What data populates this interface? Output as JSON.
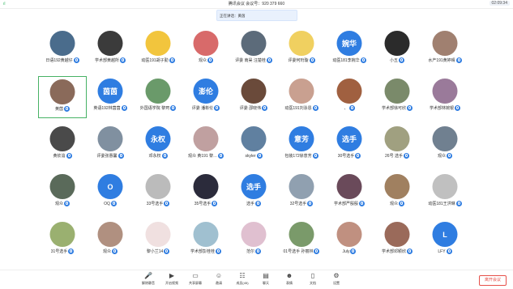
{
  "app": {
    "title_left": "腾讯会议",
    "title_sep": " 会议号：",
    "meeting_id": "920 379 660",
    "time": "02:09:34",
    "signal": "ıl"
  },
  "speaking_bar": {
    "label": "正在讲话：",
    "speaker": "黄茵"
  },
  "colors": {
    "accent": "#2f7de1",
    "leave": "#e6504a",
    "active_border": "#47b265"
  },
  "participants": [
    {
      "name": "日语192黄越仔",
      "avatar_text": "",
      "color": "#4a6c8c"
    },
    {
      "name": "学术部黄越所",
      "avatar_text": "",
      "color": "#3b3b3b"
    },
    {
      "name": "动医191胡子勤",
      "avatar_text": "",
      "color": "#f2c53d"
    },
    {
      "name": "观众",
      "avatar_text": "",
      "color": "#d86a6a"
    },
    {
      "name": "评委 南昊 汪楚桂",
      "avatar_text": "",
      "color": "#5c6b7a"
    },
    {
      "name": "评委何珩璇",
      "avatar_text": "",
      "color": "#f0d060"
    },
    {
      "name": "动医181李婉华",
      "avatar_text": "婉华",
      "color": "#2f7de1"
    },
    {
      "name": "小五",
      "avatar_text": "",
      "color": "#2b2b2b"
    },
    {
      "name": "水产191黄婷晴",
      "avatar_text": "",
      "color": "#a08070"
    },
    {
      "name": "黄茵",
      "avatar_text": "",
      "color": "#8a6a5a",
      "active": true
    },
    {
      "name": "英语192林茵茵",
      "avatar_text": "茵茵",
      "color": "#2f7de1"
    },
    {
      "name": "外国语学院 黎珂",
      "avatar_text": "",
      "color": "#6a9a6a"
    },
    {
      "name": "评委 潘彬伦",
      "avatar_text": "澎伦",
      "color": "#2f7de1"
    },
    {
      "name": "评委 邵晓伟",
      "avatar_text": "",
      "color": "#6a4a3a"
    },
    {
      "name": "动医191刘泳恩",
      "avatar_text": "",
      "color": "#c9a090"
    },
    {
      "name": "、",
      "avatar_text": "",
      "color": "#a06040"
    },
    {
      "name": "学术部徐可欣",
      "avatar_text": "",
      "color": "#7a8a6a"
    },
    {
      "name": "学术部林婉银",
      "avatar_text": "",
      "color": "#9a7a9a"
    },
    {
      "name": "黄钦渝",
      "avatar_text": "",
      "color": "#4a4a4a"
    },
    {
      "name": "评委张惠馨",
      "avatar_text": "",
      "color": "#8090a0"
    },
    {
      "name": "邓永权",
      "avatar_text": "永权",
      "color": "#2f7de1"
    },
    {
      "name": "观众 黄191 黎…",
      "avatar_text": "",
      "color": "#c0a0a0"
    },
    {
      "name": "skyler",
      "avatar_text": "",
      "color": "#6080a0"
    },
    {
      "name": "包装172徐意芳",
      "avatar_text": "意芳",
      "color": "#2f7de1"
    },
    {
      "name": "30号选手",
      "avatar_text": "选手",
      "color": "#2f7de1"
    },
    {
      "name": "26号 选手",
      "avatar_text": "",
      "color": "#a0a080"
    },
    {
      "name": "观众",
      "avatar_text": "",
      "color": "#708090"
    },
    {
      "name": "观众",
      "avatar_text": "",
      "color": "#5a6a5a"
    },
    {
      "name": "OQ",
      "avatar_text": "O",
      "color": "#2f7de1"
    },
    {
      "name": "33号选手",
      "avatar_text": "",
      "color": "#bbbbbb"
    },
    {
      "name": "35号选手",
      "avatar_text": "",
      "color": "#2b2b3b"
    },
    {
      "name": "选手",
      "avatar_text": "选手",
      "color": "#2f7de1"
    },
    {
      "name": "32号选手",
      "avatar_text": "",
      "color": "#90a0b0"
    },
    {
      "name": "学术部严殷殷",
      "avatar_text": "",
      "color": "#6a4a5a"
    },
    {
      "name": "观众",
      "avatar_text": "",
      "color": "#a08060"
    },
    {
      "name": "动医181王洪琳",
      "avatar_text": "",
      "color": "#c0c0c0"
    },
    {
      "name": "31号选手",
      "avatar_text": "",
      "color": "#9ab070"
    },
    {
      "name": "观众",
      "avatar_text": "",
      "color": "#b09080"
    },
    {
      "name": "黎小兰14",
      "avatar_text": "",
      "color": "#f0e0e0"
    },
    {
      "name": "学术部彭桂桂",
      "avatar_text": "",
      "color": "#a0c0d0"
    },
    {
      "name": "范尔",
      "avatar_text": "",
      "color": "#e0c0d0"
    },
    {
      "name": "01号选手 孙丽林",
      "avatar_text": "",
      "color": "#7a9a6a"
    },
    {
      "name": "July",
      "avatar_text": "",
      "color": "#c09080"
    },
    {
      "name": "学术部邓颖欣",
      "avatar_text": "",
      "color": "#9a6a5a"
    },
    {
      "name": "LFY",
      "avatar_text": "L",
      "color": "#2f7de1"
    }
  ],
  "toolbar": [
    {
      "label": "解除静音",
      "icon": "🎤",
      "icon_name": "microphone-icon"
    },
    {
      "label": "开启视频",
      "icon": "▶",
      "icon_name": "camera-icon"
    },
    {
      "label": "共享屏幕",
      "icon": "▭",
      "icon_name": "share-screen-icon"
    },
    {
      "label": "邀请",
      "icon": "☺",
      "icon_name": "invite-icon"
    },
    {
      "label": "成员(45)",
      "icon": "☷",
      "icon_name": "members-icon"
    },
    {
      "label": "聊天",
      "icon": "▤",
      "icon_name": "chat-icon"
    },
    {
      "label": "表情",
      "icon": "☻",
      "icon_name": "reaction-icon"
    },
    {
      "label": "文档",
      "icon": "▯",
      "icon_name": "document-icon"
    },
    {
      "label": "设置",
      "icon": "⚙",
      "icon_name": "settings-icon"
    }
  ],
  "leave_label": "离开会议"
}
